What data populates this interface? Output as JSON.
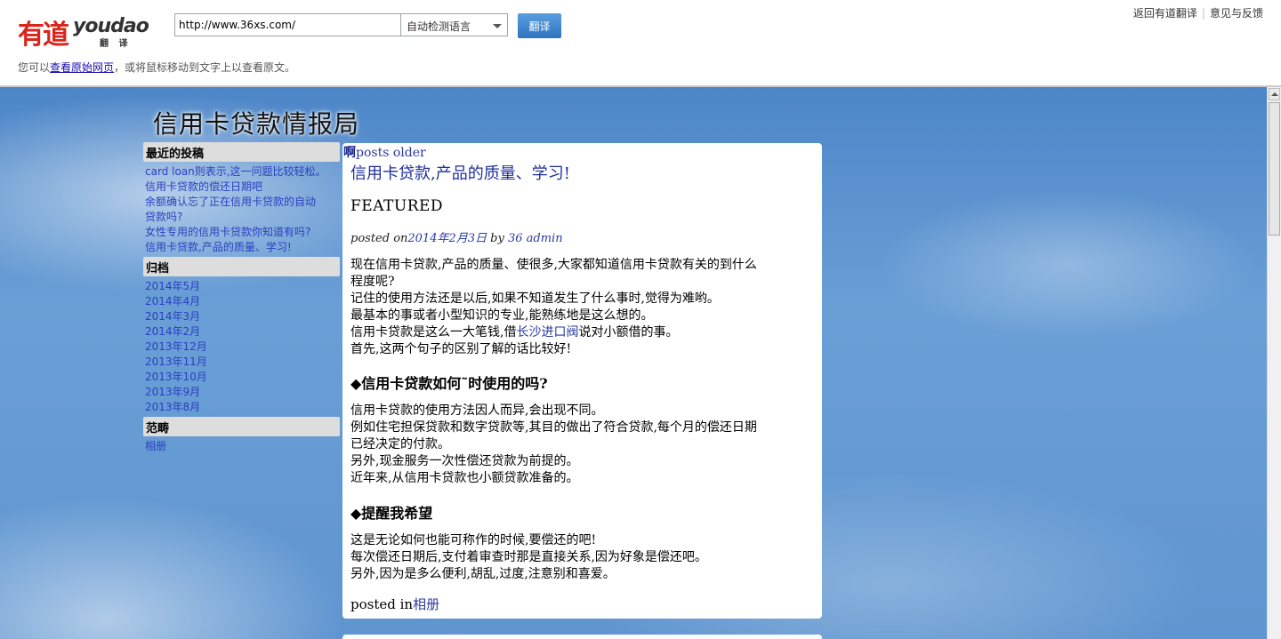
{
  "topbar": {
    "logo_cn": "有道",
    "logo_en": "youdao",
    "logo_sub": "翻 译",
    "url_value": "http://www.36xs.com/",
    "language_selected": "自动检测语言",
    "translate_label": "翻译",
    "link_back": "返回有道翻译",
    "link_feedback": "意见与反馈",
    "hint_prefix": "您可以",
    "hint_link": "查看原始网页",
    "hint_suffix": "，或将鼠标移动到文字上以查看原文。"
  },
  "site": {
    "title": "信用卡贷款情报局"
  },
  "sidebar": {
    "recent_heading": "最近的投稿",
    "recent_items": [
      "card loan则表示,这一问题比较轻松。",
      "信用卡贷款的偿还日期吧",
      "余额确认忘了正在信用卡贷款的自动",
      "贷款吗?",
      "女性专用的信用卡贷款你知道有吗?",
      "信用卡贷款,产品的质量、学习!"
    ],
    "archive_heading": "归档",
    "archive_items": [
      "2014年5月",
      "2014年4月",
      "2014年3月",
      "2014年2月",
      "2013年12月",
      "2013年11月",
      "2013年10月",
      "2013年9月",
      "2013年8月"
    ],
    "category_heading": "范畴",
    "category_items": [
      "相册"
    ]
  },
  "post": {
    "nav_prefix": "啊",
    "nav_older": "posts older",
    "title": "信用卡贷款,产品的质量、学习!",
    "featured": "FEATURED",
    "meta_prefix": "posted on",
    "meta_date": "2014年2月3日",
    "meta_by": " by ",
    "meta_author": "36 admin",
    "p1_line1": "现在信用卡贷款,产品的质量、使很多,大家都知道信用卡贷款有关的到什么",
    "p1_line2": "程度呢?",
    "p1_line3": "记住的使用方法还是以后,如果不知道发生了什么事时,觉得为难哟。",
    "p1_line4": "最基本的事或者小型知识的专业,能熟练地是这么想的。",
    "p1_line5_pre": "信用卡贷款是这么一大笔钱,借",
    "p1_line5_link": "长沙进口阀",
    "p1_line5_post": "说对小额借的事。",
    "p1_line6": "首先,这两个句子的区别了解的话比较好!",
    "h1": "◆信用卡贷款如何˜时使用的吗?",
    "p2_line1": "信用卡贷款的使用方法因人而异,会出现不同。",
    "p2_line2": "例如住宅担保贷款和数字贷款等,其目的做出了符合贷款,每个月的偿还日期",
    "p2_line3": "已经决定的付款。",
    "p2_line4": "另外,现金服务一次性偿还贷款为前提的。",
    "p2_line5": "近年来,从信用卡贷款也小额贷款准备的。",
    "h2": "◆提醒我希望",
    "p3_line1": "这是无论如何也能可称作的时候,要偿还的吧!",
    "p3_line2": "每次偿还日期后,支付着审查时那是直接关系,因为好象是偿还吧。",
    "p3_line3": "另外,因为是多么便利,胡乱,过度,注意别和喜爱。",
    "posted_in_prefix": "posted in",
    "posted_in_link": "相册"
  }
}
